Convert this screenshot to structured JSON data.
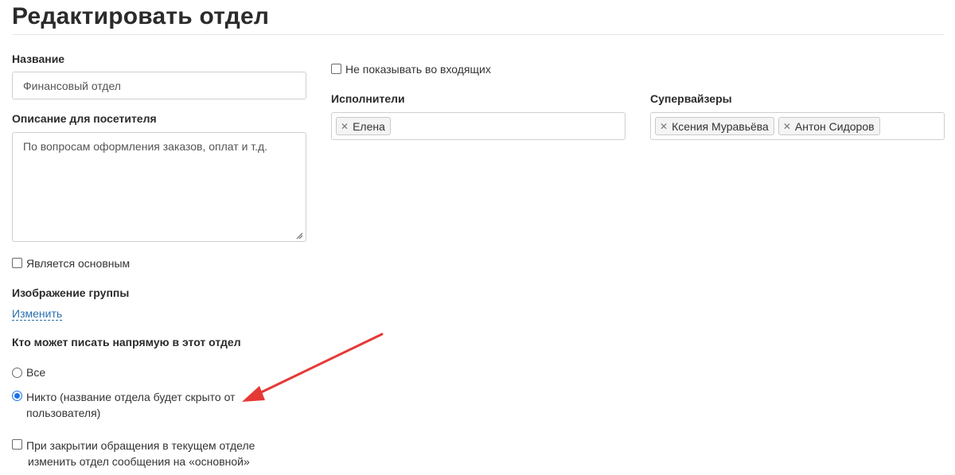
{
  "page": {
    "title": "Редактировать отдел"
  },
  "form": {
    "name_label": "Название",
    "name_value": "Финансовый отдел",
    "description_label": "Описание для посетителя",
    "description_value": "По вопросам оформления заказов, оплат и т.д.",
    "is_main_label": "Является основным",
    "is_main_checked": false,
    "image_label": "Изображение группы",
    "image_change_link": "Изменить",
    "who_can_write_label": "Кто может писать напрямую в этот отдел",
    "who_can_write_options": [
      {
        "label": "Все",
        "selected": false
      },
      {
        "label_line1": "Никто (название отдела будет скрыто от",
        "label_line2": "пользователя)",
        "selected": true
      }
    ],
    "on_close_line1": "При закрытии обращения в текущем отделе",
    "on_close_line2": "изменить отдел сообщения на «основной»",
    "on_close_checked": false,
    "hide_in_inbox_label": "Не показывать во входящих",
    "hide_in_inbox_checked": false,
    "executors_label": "Исполнители",
    "executors": [
      "Елена"
    ],
    "supervisors_label": "Супервайзеры",
    "supervisors": [
      "Ксения Муравьёва",
      "Антон Сидоров"
    ]
  },
  "colors": {
    "accent": "#1a73e8",
    "link": "#2a6fb0",
    "annotation_arrow": "#e53935"
  },
  "icons": {
    "tag_remove": "close-icon",
    "annotation": "arrow-icon"
  }
}
